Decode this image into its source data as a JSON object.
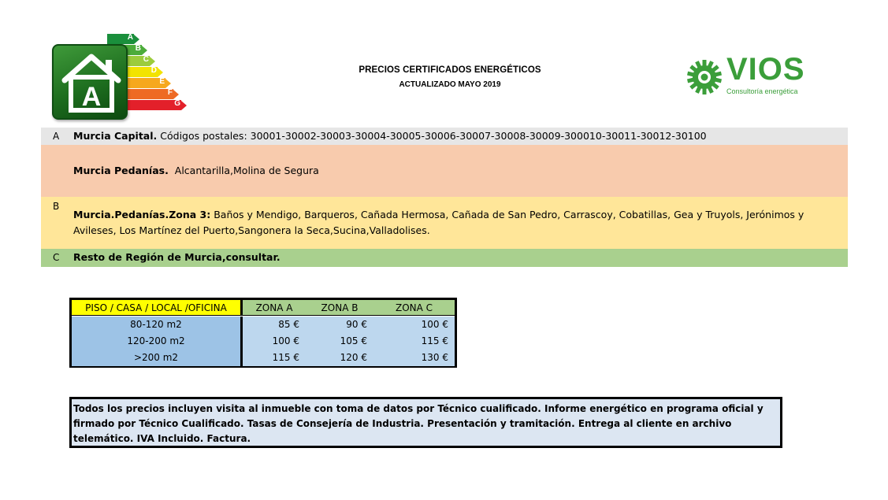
{
  "header": {
    "title": "PRECIOS CERTIFICADOS ENERGÉTICOS",
    "subtitle": "ACTUALIZADO MAYO 2019"
  },
  "energy_logo": {
    "house_letter": "A",
    "bands": [
      "A",
      "B",
      "C",
      "D",
      "E",
      "F",
      "G"
    ],
    "band_colors": [
      "#1a8f3c",
      "#4cac3a",
      "#9ccc3c",
      "#f2e300",
      "#f6a81d",
      "#ee6a24",
      "#e3202a"
    ]
  },
  "company_logo": {
    "name": "VIOS",
    "tagline": "Consultoría energética",
    "color": "#3b9e3a"
  },
  "zones": {
    "a": {
      "letter": "A",
      "name": "Murcia Capital.",
      "text": " Códigos postales: 30001-30002-30003-30004-30005-30006-30007-30008-30009-300010-30011-30012-30100"
    },
    "pedanias": {
      "name": "Murcia Pedanías.",
      "text": "  Alcantarilla,Molina de Segura"
    },
    "b": {
      "letter": "B",
      "name": "Murcia.Pedanías.Zona 3:",
      "text": " Baños y Mendigo, Barqueros, Cañada Hermosa, Cañada de San Pedro, Carrascoy, Cobatillas, Gea y Truyols, Jerónimos y Avileses, Los Martínez del Puerto,Sangonera la Seca,Sucina,Valladolises."
    },
    "c": {
      "letter": "C",
      "name": "Resto de Región de Murcia,consultar."
    },
    "colors": {
      "a": "#e6e6e6",
      "pedanias": "#f8cbad",
      "b": "#ffe699",
      "c": "#a9d08e"
    }
  },
  "price_table": {
    "headers": [
      "PISO / CASA / LOCAL /OFICINA",
      "ZONA A",
      "ZONA B",
      "ZONA C"
    ],
    "rows": [
      {
        "size": "80-120 m2",
        "a": "85 €",
        "b": "90 €",
        "c": "100 €"
      },
      {
        "size": "120-200 m2",
        "a": "100 €",
        "b": "105 €",
        "c": "115 €"
      },
      {
        "size": ">200 m2",
        "a": "115 €",
        "b": "120 €",
        "c": "130 €"
      }
    ]
  },
  "note": "Todos los precios incluyen visita al inmueble con toma de datos por Técnico cualificado. Informe energético en programa oficial y firmado por Técnico Cualificado. Tasas de Consejería de Industria. Presentación y tramitación. Entrega al cliente en archivo telemático.  IVA Incluido. Factura."
}
